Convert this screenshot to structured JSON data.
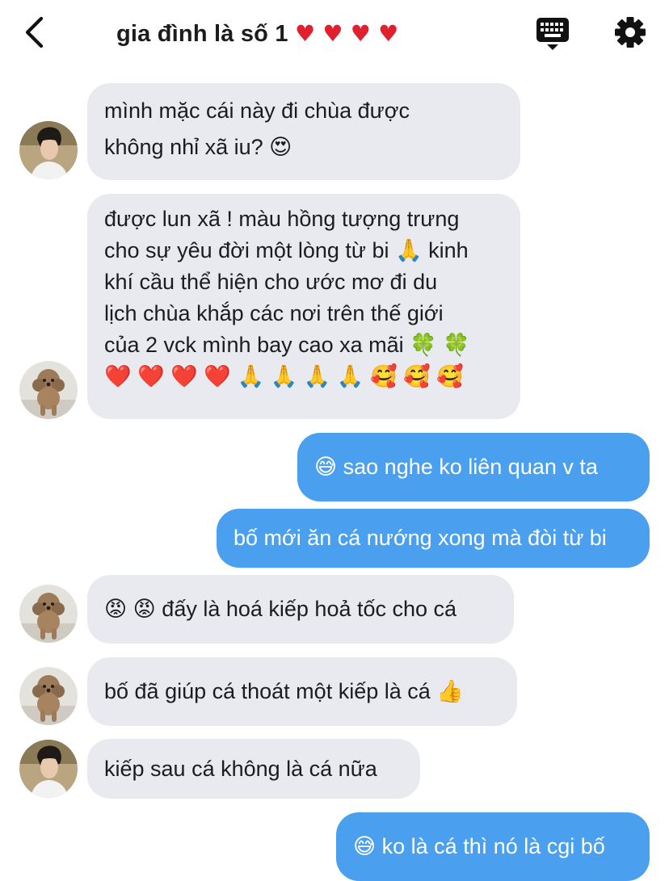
{
  "header": {
    "title": "gia đình là số 1",
    "title_hearts": "♥ ♥ ♥ ♥",
    "back_icon": "chevron-left-icon",
    "keyboard_icon": "keyboard-icon",
    "settings_icon": "gear-icon"
  },
  "messages": [
    {
      "from": "son",
      "text": "mình mặc cái này đi chùa được\nkhông nhỉ xã iu? 😍"
    },
    {
      "from": "dad",
      "text": "được lun xã ! màu hồng tượng trưng\ncho sự yêu đời một lòng từ bi 🙏  kinh\nkhí cầu thể hiện cho ước mơ đi du\nlịch chùa khắp các nơi trên thế giới\ncủa 2 vck mình bay cao xa mãi 🍀 🍀\n❤️ ❤️ ❤️ ❤️ 🙏 🙏 🙏 🙏 🥰 🥰 🥰"
    },
    {
      "from": "me",
      "text": "😅  sao nghe ko liên quan v ta"
    },
    {
      "from": "me",
      "text": "bố mới ăn cá nướng xong mà đòi từ bi"
    },
    {
      "from": "dad",
      "text": "😡 😡  đấy là hoá kiếp hoả tốc cho cá"
    },
    {
      "from": "dad",
      "text": "bố đã giúp cá thoát một kiếp là cá 👍"
    },
    {
      "from": "son",
      "text": "kiếp sau cá không là cá nữa"
    },
    {
      "from": "me",
      "text": "😅  ko là cá thì nó là cgi bố"
    }
  ],
  "colors": {
    "incoming_bubble": "#e9eaef",
    "outgoing_bubble": "#4aa0ee",
    "heart": "#e0202d"
  }
}
